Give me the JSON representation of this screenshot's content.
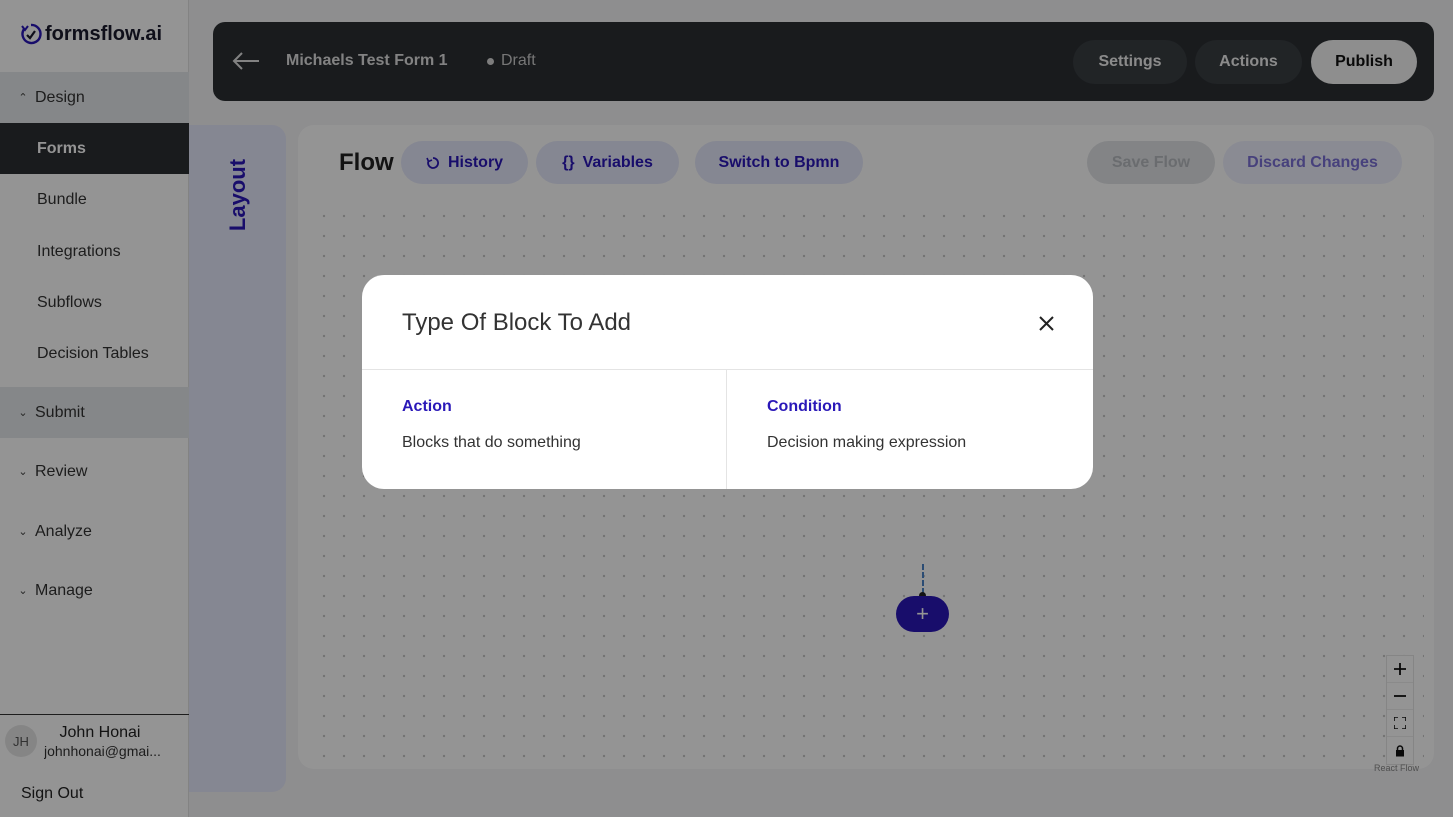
{
  "brand": {
    "name": "formsflow.ai"
  },
  "sidebar": {
    "sections": [
      {
        "label": "Design",
        "chevron": "up"
      },
      {
        "label": "Submit",
        "chevron": "down"
      },
      {
        "label": "Review",
        "chevron": "down"
      },
      {
        "label": "Analyze",
        "chevron": "down"
      },
      {
        "label": "Manage",
        "chevron": "down"
      }
    ],
    "design_items": [
      {
        "label": "Forms",
        "active": true
      },
      {
        "label": "Bundle"
      },
      {
        "label": "Integrations"
      },
      {
        "label": "Subflows"
      },
      {
        "label": "Decision Tables"
      }
    ],
    "user": {
      "initials": "JH",
      "name": "John Honai",
      "email": "johnhonai@gmai..."
    },
    "sign_out_label": "Sign Out"
  },
  "header": {
    "form_title": "Michaels Test Form 1",
    "status": "Draft",
    "settings_label": "Settings",
    "actions_label": "Actions",
    "publish_label": "Publish"
  },
  "layout_tab": {
    "label": "Layout"
  },
  "flow": {
    "title": "Flow",
    "history_label": "History",
    "variables_label": "Variables",
    "variables_icon_text": "{}",
    "switch_label": "Switch to Bpmn",
    "save_label": "Save Flow",
    "discard_label": "Discard Changes",
    "add_node_label": "+",
    "attribution": "React Flow"
  },
  "modal": {
    "title": "Type Of Block To Add",
    "options": [
      {
        "title": "Action",
        "description": "Blocks that do something"
      },
      {
        "title": "Condition",
        "description": "Decision making expression"
      }
    ]
  },
  "colors": {
    "accent": "#2a18b8",
    "dark": "#2b2f33",
    "accent_light": "#e6e8fb"
  }
}
